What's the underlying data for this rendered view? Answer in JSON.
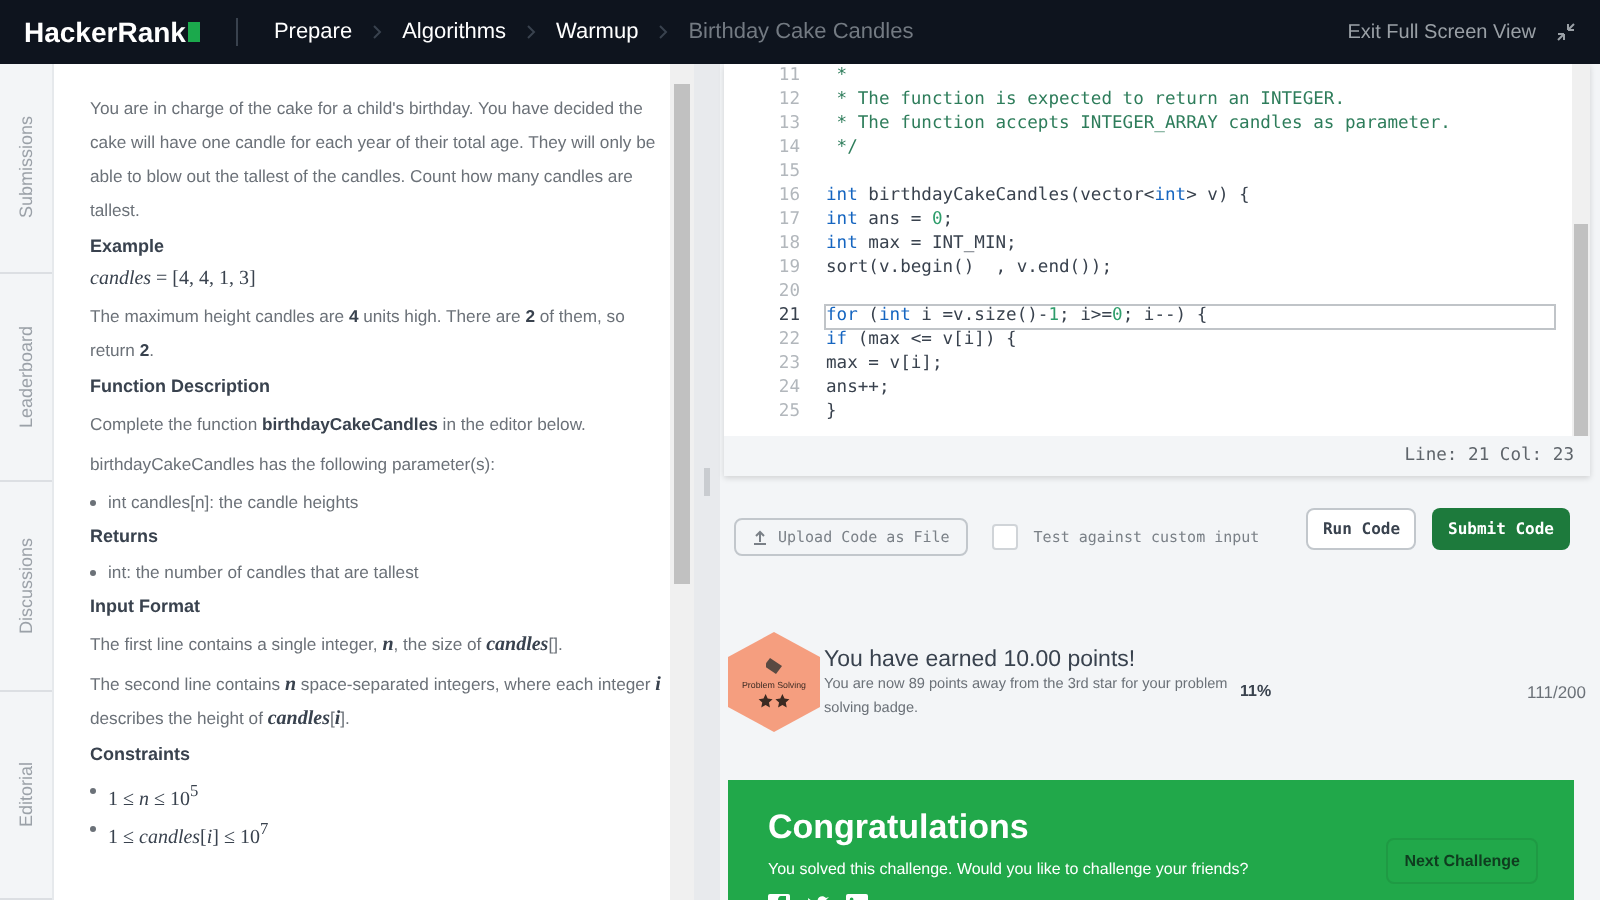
{
  "header": {
    "logo": "HackerRank",
    "breadcrumbs": [
      {
        "label": "Prepare",
        "current": false
      },
      {
        "label": "Algorithms",
        "current": false
      },
      {
        "label": "Warmup",
        "current": false
      },
      {
        "label": "Birthday Cake Candles",
        "current": true
      }
    ],
    "exit_label": "Exit Full Screen View"
  },
  "side_tabs": [
    "Submissions",
    "Leaderboard",
    "Discussions",
    "Editorial"
  ],
  "problem": [
    {
      "kind": "para",
      "text": "You are in charge of the cake for a child's birthday. You have decided the cake will have one candle for each year of their total age. They will only be able to blow out the tallest of the candles. Count how many candles are tallest."
    },
    {
      "kind": "heading",
      "text": "Example"
    },
    {
      "kind": "math",
      "text": "*candles* = [4, 4, 1, 3]"
    },
    {
      "kind": "para",
      "text": "The maximum height candles are **4** units high. There are **2** of them, so return **2**."
    },
    {
      "kind": "heading",
      "text": "Function Description"
    },
    {
      "kind": "para",
      "text": "Complete the function **birthdayCakeCandles** in the editor below."
    },
    {
      "kind": "para",
      "text": "birthdayCakeCandles has the following parameter(s):"
    },
    {
      "kind": "bullet",
      "text": "int candles[n]: the candle heights"
    },
    {
      "kind": "heading",
      "text": "Returns"
    },
    {
      "kind": "bullet",
      "text": "int: the number of candles that are tallest"
    },
    {
      "kind": "heading",
      "text": "Input Format"
    },
    {
      "kind": "para",
      "text": "The first line contains a single integer, *n*, the size of *candles*[]."
    },
    {
      "kind": "para",
      "text": "The second line contains *n* space-separated integers, where each integer *i* describes the height of *candles*[*i*]."
    },
    {
      "kind": "heading",
      "text": "Constraints"
    },
    {
      "kind": "mathbullet",
      "text": "1 ≤ *n* ≤ 10$^{5}$"
    },
    {
      "kind": "mathbullet",
      "text": "1 ≤ *candles*[*i*] ≤ 10$^{7}$"
    }
  ],
  "editor": {
    "lines": [
      {
        "number": "11",
        "current": false,
        "tokens": [
          {
            "kind": "comment",
            "text": " *"
          }
        ]
      },
      {
        "number": "12",
        "current": false,
        "tokens": [
          {
            "kind": "comment",
            "text": " * The function is expected to return an INTEGER."
          }
        ]
      },
      {
        "number": "13",
        "current": false,
        "tokens": [
          {
            "kind": "comment",
            "text": " * The function accepts INTEGER_ARRAY candles as parameter."
          }
        ]
      },
      {
        "number": "14",
        "current": false,
        "tokens": [
          {
            "kind": "comment",
            "text": " */"
          }
        ]
      },
      {
        "number": "15",
        "current": false
      },
      {
        "number": "16",
        "current": false,
        "tokens": [
          {
            "kind": "keyword",
            "text": "int"
          },
          {
            "kind": "plain",
            "text": " birthdayCakeCandles(vector<"
          },
          {
            "kind": "keyword",
            "text": "int"
          },
          {
            "kind": "plain",
            "text": "> v) {"
          }
        ]
      },
      {
        "number": "17",
        "current": false,
        "tokens": [
          {
            "kind": "keyword",
            "text": "int"
          },
          {
            "kind": "plain",
            "text": " ans = "
          },
          {
            "kind": "number",
            "text": "0"
          },
          {
            "kind": "plain",
            "text": ";"
          }
        ]
      },
      {
        "number": "18",
        "current": false,
        "tokens": [
          {
            "kind": "keyword",
            "text": "int"
          },
          {
            "kind": "plain",
            "text": " max = INT_MIN;"
          }
        ]
      },
      {
        "number": "19",
        "current": false,
        "tokens": [
          {
            "kind": "plain",
            "text": "sort(v.begin()  , v.end());"
          }
        ]
      },
      {
        "number": "20",
        "current": false
      },
      {
        "number": "21",
        "current": true,
        "tokens": [
          {
            "kind": "keyword",
            "text": "for"
          },
          {
            "kind": "plain",
            "text": " ("
          },
          {
            "kind": "keyword",
            "text": "int"
          },
          {
            "kind": "plain",
            "text": " i =v.size()-"
          },
          {
            "kind": "number",
            "text": "1"
          },
          {
            "kind": "plain",
            "text": "; i>="
          },
          {
            "kind": "number",
            "text": "0"
          },
          {
            "kind": "plain",
            "text": "; i--) {"
          }
        ]
      },
      {
        "number": "22",
        "current": false,
        "tokens": [
          {
            "kind": "keyword",
            "text": "if"
          },
          {
            "kind": "plain",
            "text": " (max <= v[i]) {"
          }
        ]
      },
      {
        "number": "23",
        "current": false,
        "tokens": [
          {
            "kind": "plain",
            "text": "max = v[i];"
          }
        ]
      },
      {
        "number": "24",
        "current": false,
        "tokens": [
          {
            "kind": "plain",
            "text": "ans++;"
          }
        ]
      },
      {
        "number": "25",
        "current": false,
        "tokens": [
          {
            "kind": "plain",
            "text": "}"
          }
        ]
      }
    ],
    "status": "Line: 21 Col: 23"
  },
  "actions": {
    "upload": "Upload Code as File",
    "custom_input": {
      "label": "Test against custom input",
      "checked": false
    },
    "run": "Run Code",
    "submit": "Submit Code"
  },
  "badge": {
    "name": "Problem Solving",
    "title": "You have earned 10.00 points!",
    "message": "You are now 89 points away from the 3rd star for your problem solving badge.",
    "percent": "11%",
    "score": "111/200"
  },
  "congrats": {
    "title": "Congratulations",
    "message": "You solved this challenge. Would you like to challenge your friends?",
    "next": "Next Challenge"
  }
}
